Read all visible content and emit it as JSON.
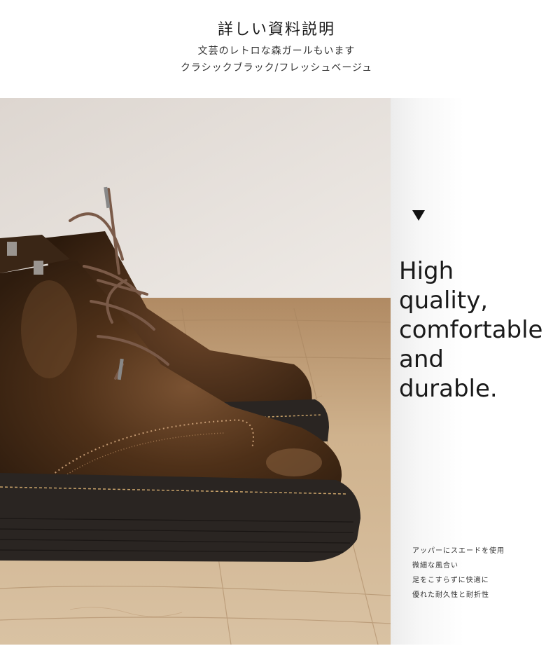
{
  "header": {
    "title": "詳しい資料説明",
    "subtitle_1": "文芸のレトロな森ガールもいます",
    "subtitle_2": "クラシックブラック/フレッシュベージュ"
  },
  "photo": {
    "subject": "brown leather lace-up brogue platform ankle boots on a wooden floor"
  },
  "side": {
    "arrow_icon": "triangle-down-icon",
    "headline_lines": [
      "High",
      "quality,",
      "comfortable",
      "and",
      "durable."
    ],
    "features": [
      "アッパーにスエードを使用",
      "微細な風合い",
      "足をこすらずに快適に",
      "優れた耐久性と耐折性"
    ]
  },
  "colors": {
    "leather": "#5a3a22",
    "sole": "#2a2522",
    "wood": "#c9ab86",
    "wall": "#e7e2de"
  }
}
